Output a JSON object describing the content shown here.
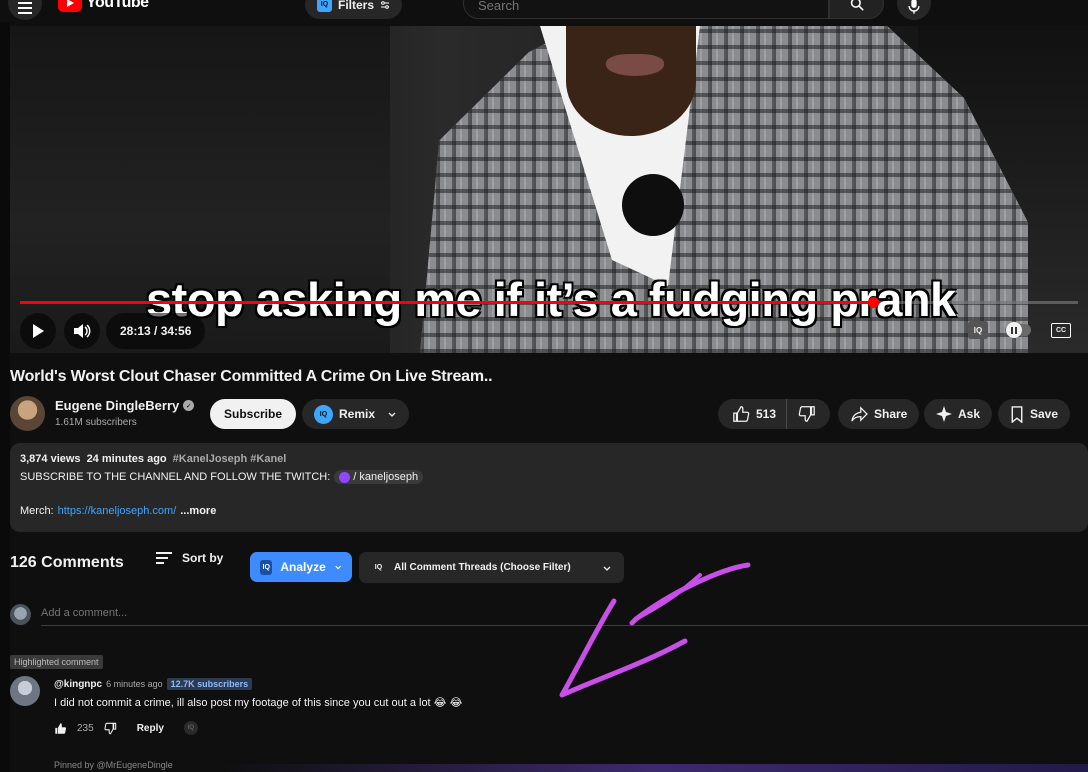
{
  "header": {
    "logo_text": "YouTube",
    "filters_label": "Filters",
    "filters_badge": "IQ",
    "search_placeholder": "Search"
  },
  "player": {
    "caption": "stop asking me if it’s a fudging prank",
    "time_display": "28:13 / 34:56",
    "progress": 0.8073,
    "iq_label": "IQ",
    "cc_label": "CC"
  },
  "video": {
    "title": "World's Worst Clout Chaser Committed A Crime On Live Stream..",
    "channel_name": "Eugene DingleBerry",
    "subscribers": "1.61M subscribers",
    "subscribe_label": "Subscribe",
    "remix_label": "Remix",
    "remix_badge": "IQ",
    "like_count": "513",
    "share_label": "Share",
    "ask_label": "Ask",
    "save_label": "Save"
  },
  "description": {
    "views": "3,874 views",
    "posted": "24 minutes ago",
    "tags": "#KanelJoseph #Kanel",
    "line1": "SUBSCRIBE TO THE CHANNEL AND FOLLOW THE TWITCH:",
    "twitch_handle": "/ kaneljoseph",
    "merch_label": "Merch:",
    "merch_link": "https://kaneljoseph.com/",
    "more_label": "...more"
  },
  "comments": {
    "count": "126 Comments",
    "sort_label": "Sort by",
    "analyze_label": "Analyze",
    "analyze_badge": "IQ",
    "filter_label": "All Comment Threads (Choose Filter)",
    "filter_badge": "IQ",
    "add_placeholder": "Add a comment...",
    "highlighted_label": "Highlighted comment",
    "items": [
      {
        "author": "@kingnpc",
        "time": "6 minutes ago",
        "subs_badge": "12.7K subscribers",
        "text": "I did not commit a crime, ill also post my footage of this since you cut out a lot 😂 😂",
        "likes": "235",
        "reply_label": "Reply",
        "iq_label": "IQ",
        "pinned_note": "Pinned by @MrEugeneDingle"
      }
    ]
  },
  "colors": {
    "accent_red": "#ff0000",
    "progress_red": "#ff0000",
    "analyze_blue": "#3e8bff",
    "annotation_purple": "#c84fe8"
  }
}
